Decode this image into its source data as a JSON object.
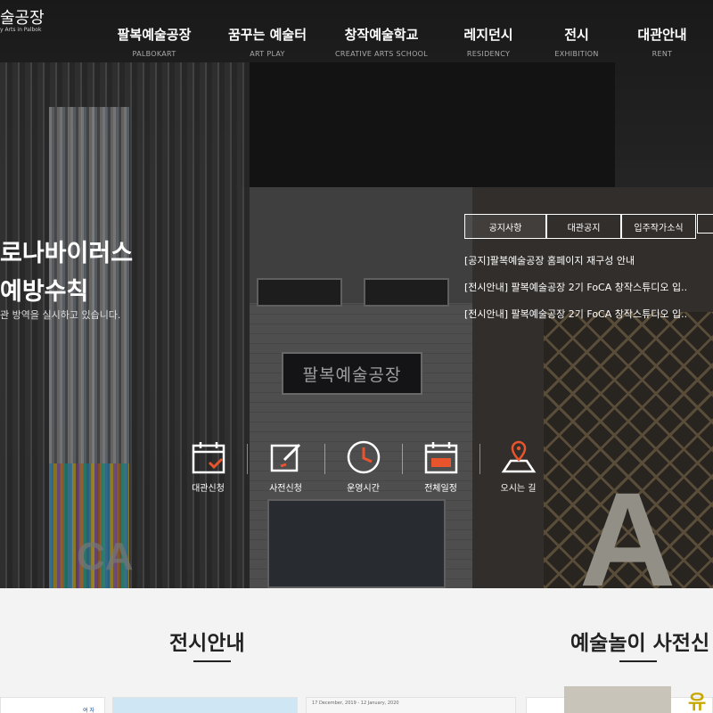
{
  "header": {
    "logo_text": "술공장",
    "logo_sub": "y Arts in Palbok",
    "nav": [
      {
        "ko": "팔복예술공장",
        "en": "PALBOKART"
      },
      {
        "ko": "꿈꾸는 예술터",
        "en": "ART PLAY"
      },
      {
        "ko": "창작예술학교",
        "en": "CREATIVE ARTS SCHOOL"
      },
      {
        "ko": "레지던시",
        "en": "RESIDENCY"
      },
      {
        "ko": "전시",
        "en": "EXHIBITION"
      },
      {
        "ko": "대관안내",
        "en": "RENT"
      }
    ]
  },
  "hero": {
    "title_line1": "로나바이러스",
    "title_line2": "예방수칙",
    "subtitle": "관 방역을 실시하고 있습니다.",
    "sign_text": "팔복예술공장",
    "letter": "A",
    "fca_text": "CA"
  },
  "notices": {
    "tabs": [
      "공지사항",
      "대관공지",
      "입주작가소식"
    ],
    "items": [
      "[공지]팔복예술공장 홈페이지 재구성 안내",
      "[전시안내] 팔복예술공장 2기 FoCA 창작스튜디오 입..",
      "[전시안내] 팔복예술공장 2기 FoCA 창작스튜디오 입.."
    ]
  },
  "quick_menu": [
    {
      "label": "대관신청",
      "icon": "calendar-check-icon"
    },
    {
      "label": "사전신청",
      "icon": "edit-icon"
    },
    {
      "label": "운영시간",
      "icon": "clock-icon"
    },
    {
      "label": "전체일정",
      "icon": "calendar-icon"
    },
    {
      "label": "오시는 길",
      "icon": "map-pin-icon"
    }
  ],
  "sections": {
    "exhibition_title": "전시안내",
    "art_play_title": "예술놀이 사전신",
    "card_date": "17 December, 2019 - 12 January, 2020",
    "card_tag": "여 자",
    "card_thumb_text": "유"
  },
  "colors": {
    "accent": "#e8542c",
    "text_dark": "#222222"
  }
}
